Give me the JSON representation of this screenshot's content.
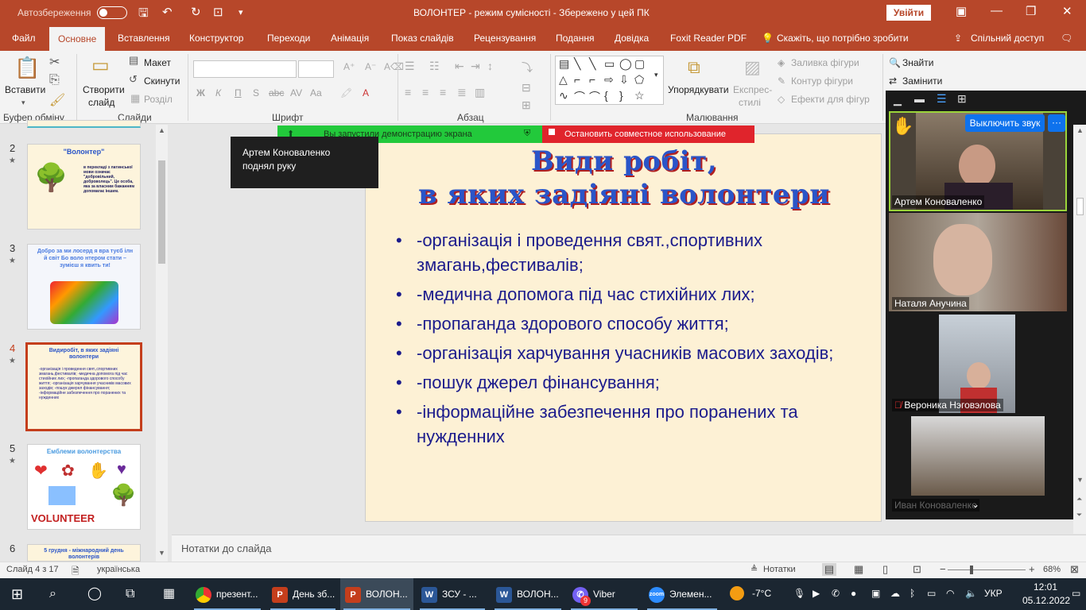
{
  "titlebar": {
    "autosave": "Автозбереження",
    "title": "ВОЛОНТЕР  -  режим сумісності  -  Збережено у цей ПК",
    "signin": "Увійти"
  },
  "tabs": [
    {
      "label": "Файл"
    },
    {
      "label": "Основне"
    },
    {
      "label": "Вставлення"
    },
    {
      "label": "Конструктор"
    },
    {
      "label": "Переходи"
    },
    {
      "label": "Анімація"
    },
    {
      "label": "Показ слайдів"
    },
    {
      "label": "Рецензування"
    },
    {
      "label": "Подання"
    },
    {
      "label": "Довідка"
    },
    {
      "label": "Foxit Reader PDF"
    },
    {
      "label": "Скажіть, що потрібно зробити"
    },
    {
      "label": "Спільний доступ"
    }
  ],
  "ribbon": {
    "paste": "Вставити",
    "clipboard_group": "Буфер обміну",
    "new_slide_1": "Створити",
    "new_slide_2": "слайд",
    "layout": "Макет",
    "reset": "Скинути",
    "section": "Розділ",
    "slides_group": "Слайди",
    "font_group": "Шрифт",
    "bold": "Ж",
    "italic": "К",
    "underline": "П",
    "strike": "abc",
    "spacing": "AV",
    "case": "Aa",
    "paragraph_group": "Абзац",
    "arrange_1": "Упорядкувати",
    "quick_1": "Експрес-",
    "quick_2": "стилі",
    "fill": "Заливка фігури",
    "outline": "Контур фігури",
    "effects": "Ефекти для фігур",
    "drawing_group": "Малювання",
    "find": "Знайти",
    "replace": "Замінити"
  },
  "share": {
    "started": "Вы запустили демонстрацию экрана",
    "stop": "Остановить совместное использование"
  },
  "tooltip": {
    "line1": "Артем Коноваленко",
    "line2": "поднял руку"
  },
  "thumbnails": [
    {
      "num": "2",
      "title": "\"Волонтер\"",
      "text": "в перекладі з латинської мови означає \"добровільний, доброволець\". Це особа, яка за власним бажанням допомагає іншим."
    },
    {
      "num": "3",
      "title": "Добро за ми лосерд я вра туєб ілн й світ Бо воло нтером стати – зумієш я квить ти!",
      "text": ""
    },
    {
      "num": "4",
      "title": "Видиробіт, в яких задіяні волонтери",
      "text": "-організація і проведення свят.,спортивних змагань,фестивалів; -медична допомога під час стихійних лих; -пропаганда здорового способу життя; -організація харчування учасників масових заходів; -пошук джерел фінансування; -інформаційне забезпечення про поранених та нужденних"
    },
    {
      "num": "5",
      "title": "Емблеми волонтерства",
      "text": "VOLUNTEER"
    },
    {
      "num": "6",
      "title": "5 грудня - міжнародний день волонтерів",
      "text": ""
    }
  ],
  "slide": {
    "title_line1": "Види робіт,",
    "title_line2": "в яких задіяні волонтери",
    "bullets": [
      "-організація  і проведення свят.,спортивних змагань,фестивалів;",
      "-медична допомога під час стихійних лих;",
      "-пропаганда здорового способу життя;",
      "-організація харчування учасників масових заходів;",
      "-пошук джерел фінансування;",
      "-інформаційне забезпечення  про поранених та нужденних"
    ]
  },
  "notes": "Нотатки до слайда",
  "status": {
    "slide": "Слайд 4 з 17",
    "language": "українська",
    "notes_btn": "Нотатки",
    "zoom": "68%"
  },
  "zoom_panel": {
    "mute_btn": "Выключить звук",
    "more_btn": "···",
    "participants": [
      {
        "name": "Артем Коноваленко"
      },
      {
        "name": "Наталя Анучина"
      },
      {
        "name": "Вероника Нэговэлова"
      },
      {
        "name": "Иван Коноваленко"
      }
    ]
  },
  "taskbar": {
    "items": [
      {
        "label": "презент...",
        "icon": "chrome-icon"
      },
      {
        "label": "День зб...",
        "icon": "powerpoint-icon"
      },
      {
        "label": "ВОЛОН...",
        "icon": "powerpoint-icon"
      },
      {
        "label": "ЗСУ - ...",
        "icon": "word-icon"
      },
      {
        "label": "ВОЛОН...",
        "icon": "word-icon"
      },
      {
        "label": "Viber",
        "icon": "viber-icon",
        "badge": "9"
      },
      {
        "label": "Элемен...",
        "icon": "zoom-icon"
      }
    ],
    "weather": "-7°C",
    "lang": "УКР",
    "time": "12:01",
    "date": "05.12.2022"
  },
  "colors": {
    "accent": "#b7472a",
    "slide_title": "#2a55c8",
    "bullet_text": "#1b1b8c"
  }
}
